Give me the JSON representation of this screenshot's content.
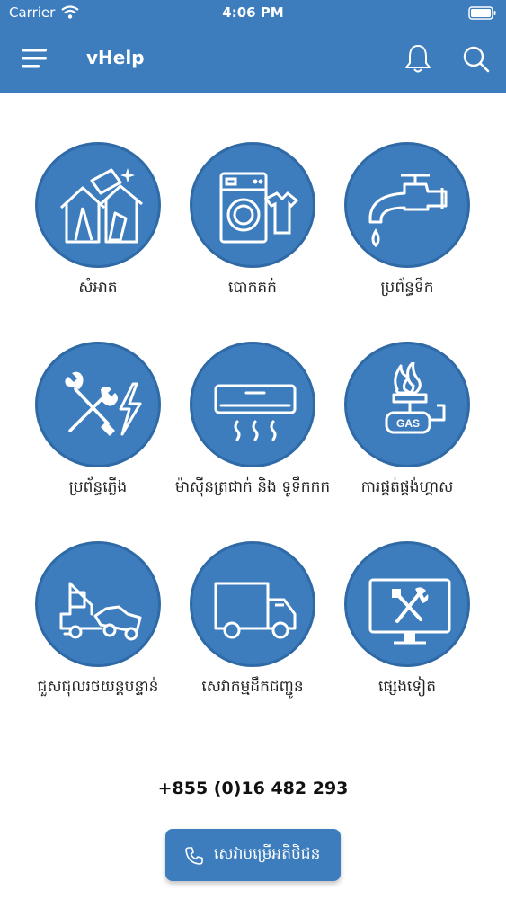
{
  "status_bar": {
    "carrier": "Carrier",
    "time": "4:06 PM"
  },
  "header": {
    "title": "vHelp"
  },
  "services": [
    {
      "label": "សំអាត",
      "icon": "house-cleaning-icon"
    },
    {
      "label": "បោកគក់",
      "icon": "washing-machine-icon"
    },
    {
      "label": "ប្រព័ន្ធទឹក",
      "icon": "water-tap-icon"
    },
    {
      "label": "ប្រព័ន្ធភ្លើង",
      "icon": "electrical-tools-icon"
    },
    {
      "label": "ម៉ាស៊ីនត្រជាក់ និង ទូទឹកកក",
      "icon": "air-conditioner-icon"
    },
    {
      "label": "ការផ្គត់ផ្គង់ហ្គាស",
      "icon": "gas-icon"
    },
    {
      "label": "ជួសជុលរថយន្តបន្ទាន់",
      "icon": "tow-truck-icon"
    },
    {
      "label": "សេវាកម្មដឹកជញ្ជូន",
      "icon": "delivery-truck-icon"
    },
    {
      "label": "ផ្សេងទៀត",
      "icon": "monitor-tools-icon"
    }
  ],
  "contact": {
    "phone": "+855 (0)16 482 293",
    "call_button_label": "សេវាបម្រើអតិថិជន"
  },
  "colors": {
    "primary": "#3d7dbd",
    "text": "#222222"
  }
}
